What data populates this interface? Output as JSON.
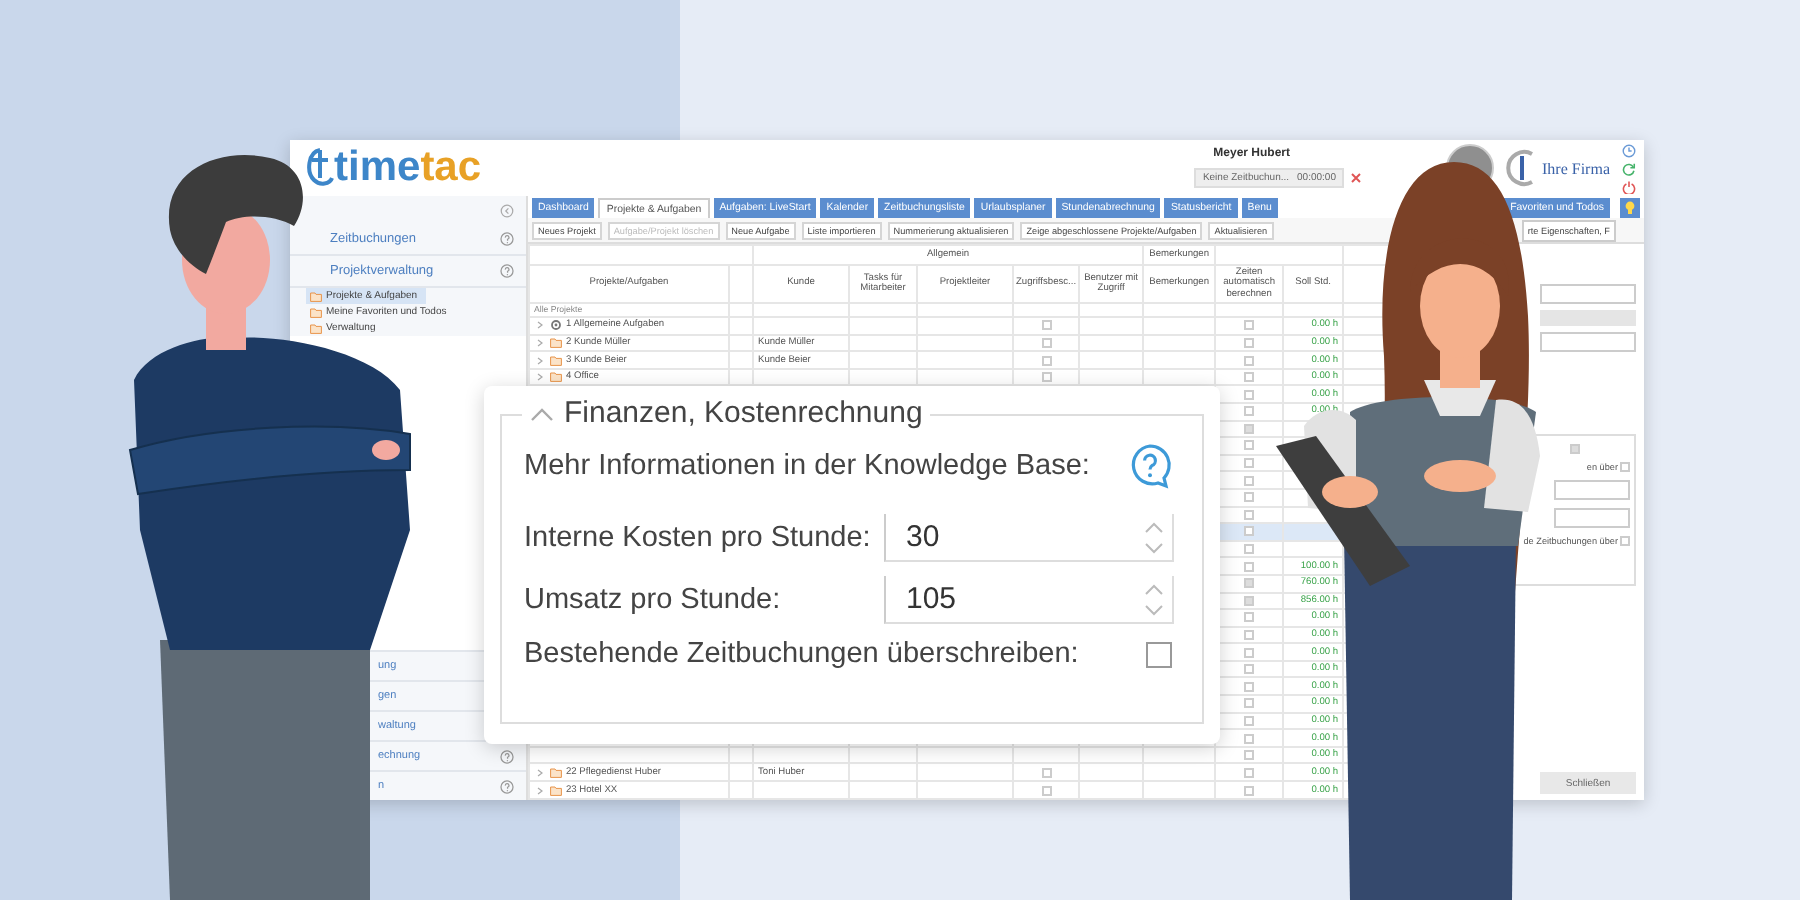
{
  "app": {
    "logo": {
      "part_1": "time",
      "part_2": "tac"
    },
    "user_name": "Meyer Hubert",
    "time_tracker": {
      "status": "Keine Zeitbuchun...",
      "timer": "00:00:00"
    },
    "company_logo": "Ihre Firma"
  },
  "sidebar": {
    "sections": [
      {
        "label": "Zeitbuchungen"
      },
      {
        "label": "Projektverwaltung",
        "children": [
          {
            "label": "Projekte & Aufgaben",
            "selected": true
          },
          {
            "label": "Meine Favoriten und Todos",
            "selected": false
          },
          {
            "label": "Verwaltung",
            "selected": false
          }
        ]
      }
    ],
    "bottom_items": [
      {
        "label": "ung",
        "help": false
      },
      {
        "label": "gen",
        "help": false
      },
      {
        "label": "waltung",
        "help": false
      },
      {
        "label": "echnung",
        "help": true
      },
      {
        "label": "n",
        "help": true
      }
    ]
  },
  "tabs": [
    {
      "label": "Dashboard",
      "selected": false
    },
    {
      "label": "Projekte & Aufgaben",
      "selected": true
    },
    {
      "label": "Aufgaben: LiveStart",
      "selected": false
    },
    {
      "label": "Kalender",
      "selected": false
    },
    {
      "label": "Zeitbuchungsliste",
      "selected": false
    },
    {
      "label": "Urlaubsplaner",
      "selected": false
    },
    {
      "label": "Stundenabrechnung",
      "selected": false
    },
    {
      "label": "Statusbericht",
      "selected": false
    },
    {
      "label": "Benu",
      "selected": false
    },
    {
      "label": "Favoriten und Todos",
      "selected": false
    }
  ],
  "toolbar": {
    "buttons": [
      {
        "label": "Neues Projekt",
        "disabled": false
      },
      {
        "label": "Aufgabe/Projekt löschen",
        "disabled": true
      },
      {
        "label": "Neue Aufgabe",
        "disabled": false
      },
      {
        "label": "Liste importieren",
        "disabled": false
      },
      {
        "label": "Nummerierung aktualisieren",
        "disabled": false
      },
      {
        "label": "Zeige abgeschlossene Projekte/Aufgaben",
        "disabled": false
      },
      {
        "label": "Aktualisieren",
        "disabled": false
      }
    ],
    "property_select": "rte Eigenschaften, F"
  },
  "table": {
    "column_groups": [
      {
        "columns": [
          {
            "label": "Projekte/Aufgaben"
          }
        ]
      },
      {
        "label": "Allgemein",
        "columns": [
          {
            "label": "Kunde"
          },
          {
            "label": "Tasks für Mitarbeiter"
          },
          {
            "label": "Projektleiter"
          },
          {
            "label": "Zugriffsbesc..."
          },
          {
            "label": "Benutzer mit Zugriff"
          }
        ]
      },
      {
        "label": "Bemerkungen",
        "columns": [
          {
            "label": "Bemerkungen"
          }
        ]
      },
      {
        "columns": [
          {
            "label": "Zeiten automatisch berechnen"
          },
          {
            "label": "Soll Std."
          }
        ]
      }
    ],
    "filter_placeholder": "Alle Projekte",
    "rows": [
      {
        "kind": "gear",
        "name": "1 Allgemeine Aufgaben",
        "restricted": false,
        "auto_calc": false,
        "soll": "0.00 h",
        "selected": false
      },
      {
        "kind": "folder",
        "name": "2 Kunde Müller",
        "customer": "Kunde Müller",
        "restricted": false,
        "auto_calc": false,
        "soll": "0.00 h",
        "selected": false
      },
      {
        "kind": "folder",
        "name": "3 Kunde Beier",
        "customer": "Kunde Beier",
        "restricted": false,
        "auto_calc": false,
        "soll": "0.00 h",
        "selected": false
      },
      {
        "kind": "folder",
        "name": "4 Office",
        "restricted": false,
        "auto_calc": false,
        "soll": "0.00 h",
        "selected": false
      },
      {
        "auto_calc": false,
        "soll": "0.00 h",
        "selected": false
      },
      {
        "auto_calc": false,
        "soll": "0.00 h",
        "selected": false
      },
      {
        "auto_calc": true,
        "selected": false
      },
      {
        "auto_calc": false,
        "selected": false
      },
      {
        "auto_calc": false,
        "selected": false
      },
      {
        "auto_calc": false,
        "selected": false
      },
      {
        "auto_calc": false,
        "selected": false
      },
      {
        "auto_calc": false,
        "selected": false
      },
      {
        "auto_calc": false,
        "selected": true
      },
      {
        "auto_calc": false,
        "selected": false
      },
      {
        "auto_calc": false,
        "soll": "100.00 h",
        "selected": false
      },
      {
        "auto_calc": true,
        "soll": "760.00 h",
        "selected": false
      },
      {
        "auto_calc": true,
        "soll": "856.00 h",
        "selected": false
      },
      {
        "auto_calc": false,
        "soll": "0.00 h",
        "selected": false
      },
      {
        "auto_calc": false,
        "soll": "0.00 h",
        "selected": false
      },
      {
        "auto_calc": false,
        "soll": "0.00 h",
        "selected": false
      },
      {
        "auto_calc": false,
        "soll": "0.00 h",
        "selected": false
      },
      {
        "auto_calc": false,
        "soll": "0.00 h",
        "selected": false
      },
      {
        "auto_calc": false,
        "soll": "0.00 h",
        "selected": false
      },
      {
        "auto_calc": false,
        "soll": "0.00 h",
        "selected": false
      },
      {
        "auto_calc": false,
        "soll": "0.00 h",
        "selected": false
      },
      {
        "auto_calc": false,
        "soll": "0.00 h",
        "selected": false
      },
      {
        "kind": "folder",
        "name": "22 Pflegedienst Huber",
        "customer": "Toni Huber",
        "restricted": false,
        "auto_calc": false,
        "soll": "0.00 h",
        "selected": false
      },
      {
        "kind": "folder",
        "name": "23 Hotel XX",
        "restricted": false,
        "auto_calc": false,
        "soll": "0.00 h",
        "selected": false
      }
    ]
  },
  "side_panel": {
    "fieldset_checked": true,
    "labels": [
      {
        "label": "en über",
        "checked": false
      },
      {
        "label": "de Zeitbuchungen über",
        "checked": false
      }
    ],
    "close_button": "Schließen"
  },
  "dialog": {
    "legend": "Finanzen, Kostenrechnung",
    "expanded": true,
    "info_label": "Mehr Informationen in der Knowledge Base:",
    "fields": [
      {
        "label": "Interne Kosten pro Stunde:",
        "value": "30"
      },
      {
        "label": "Umsatz pro Stunde:",
        "value": "105"
      }
    ],
    "overwrite": {
      "label": "Bestehende Zeitbuchungen überschreiben:",
      "checked": false
    }
  }
}
